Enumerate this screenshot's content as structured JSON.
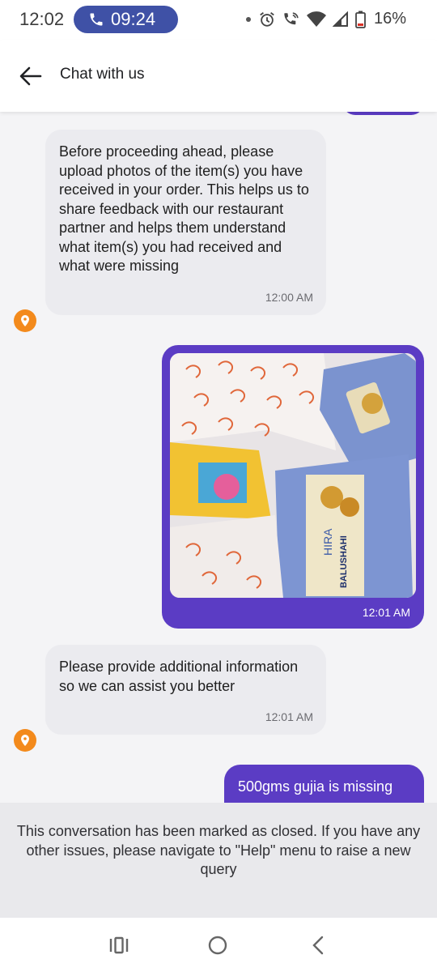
{
  "status_bar": {
    "time": "12:02",
    "call_time": "09:24",
    "battery": "16%",
    "icons": [
      "dot-icon",
      "alarm-icon",
      "wifi-call-icon",
      "wifi-icon",
      "signal-icon",
      "battery-icon"
    ]
  },
  "header": {
    "title": "Chat with us",
    "back_icon": "arrow-left-icon"
  },
  "messages": [
    {
      "type": "incoming",
      "text": "Before proceeding ahead, please upload photos of the item(s) you have received in your order. This helps us to share feedback with our restaurant partner and helps them understand what item(s) you had received and what were missing",
      "time": "12:00 AM"
    },
    {
      "type": "outgoing-image",
      "image_label": "HIRA",
      "image_product": "BALUSHAHI",
      "time": "12:01 AM"
    },
    {
      "type": "incoming",
      "text": "Please provide additional information so we can assist you better",
      "time": "12:01 AM"
    },
    {
      "type": "outgoing",
      "text": "500gms gujia is missing"
    }
  ],
  "closed_notice": "This conversation has been marked as closed. If you have any other issues, please navigate to \"Help\" menu to raise a new query",
  "nav": [
    "recents-icon",
    "home-icon",
    "back-icon"
  ],
  "colors": {
    "accent": "#5b3cc4",
    "bot_icon": "#f38a1c",
    "incoming_bubble": "#ebebef",
    "call_pill": "#3f51a6"
  }
}
